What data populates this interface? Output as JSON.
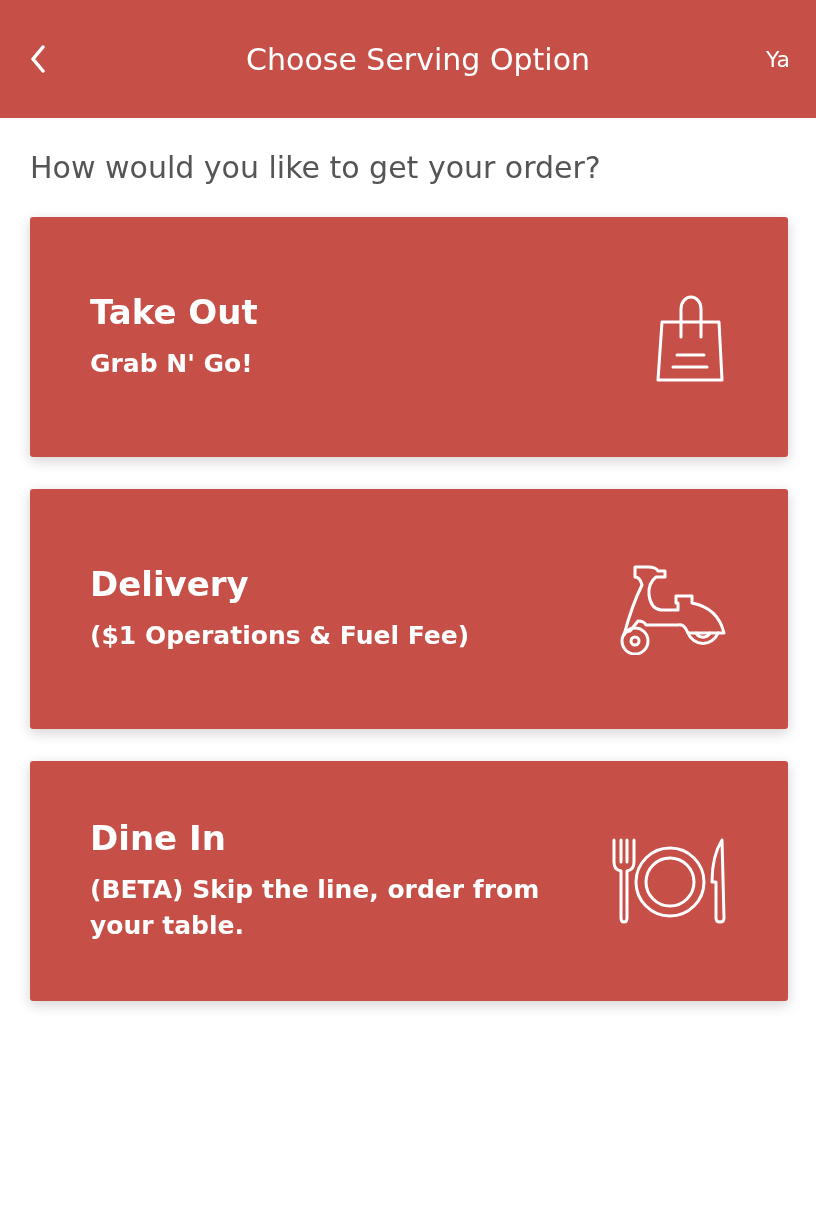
{
  "header": {
    "title": "Choose Serving Option",
    "user": "Ya"
  },
  "prompt": "How would you like to get your order?",
  "options": [
    {
      "kind": "takeout",
      "title": "Take Out",
      "subtitle": "Grab N' Go!"
    },
    {
      "kind": "delivery",
      "title": "Delivery",
      "subtitle": "($1 Operations & Fuel Fee)"
    },
    {
      "kind": "dinein",
      "title": "Dine In",
      "subtitle": "(BETA) Skip the line, order from your table."
    }
  ]
}
